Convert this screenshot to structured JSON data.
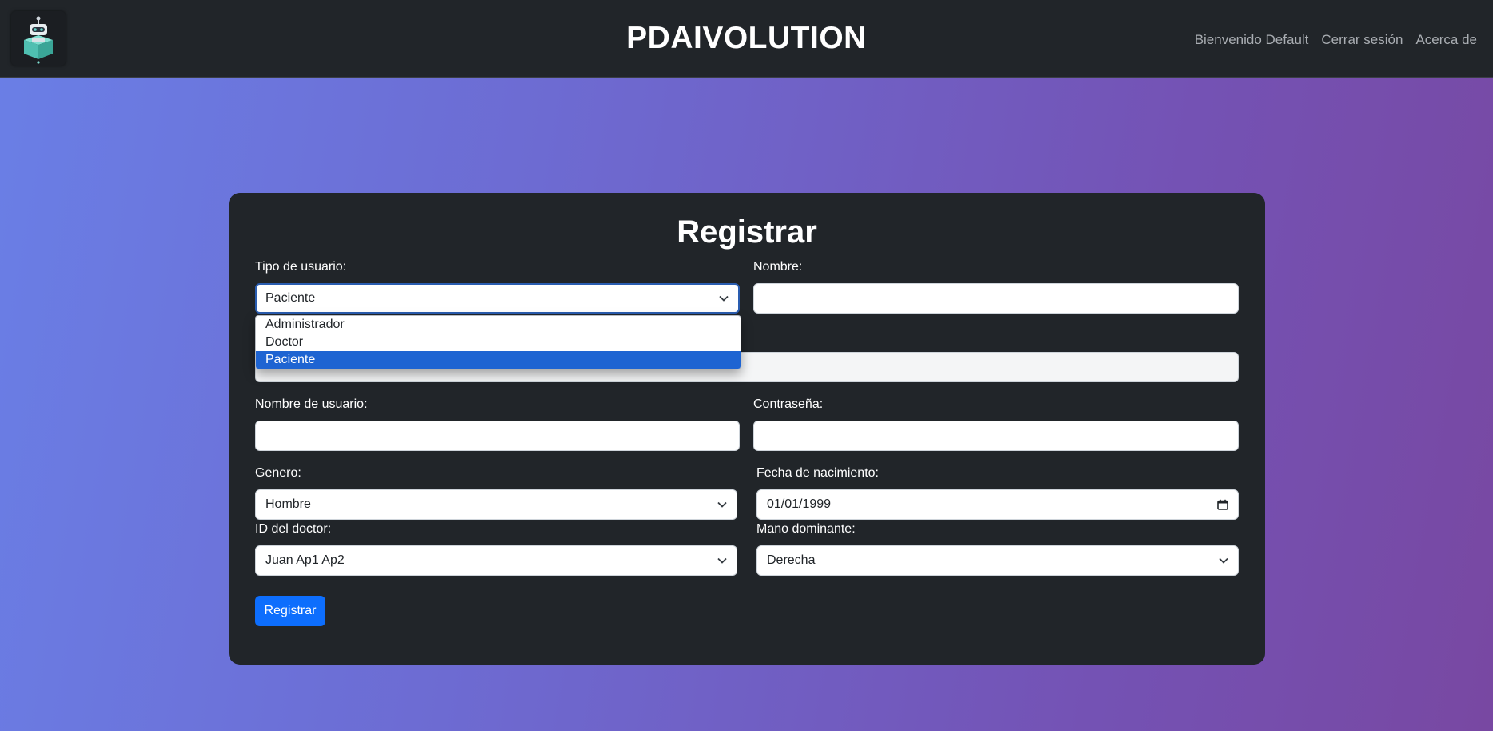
{
  "header": {
    "brand": "PDAIVOLUTION",
    "logo_icon": "robot-logo-icon",
    "links": [
      "Bienvenido Default",
      "Cerrar sesión",
      "Acerca de"
    ]
  },
  "form": {
    "title": "Registrar",
    "tipo_usuario": {
      "label": "Tipo de usuario:",
      "value": "Paciente",
      "options": [
        "Administrador",
        "Doctor",
        "Paciente"
      ],
      "selected_index": 2
    },
    "nombre": {
      "label": "Nombre:",
      "value": ""
    },
    "nombre_usuario": {
      "label": "Nombre de usuario:",
      "value": ""
    },
    "contrasena": {
      "label": "Contraseña:",
      "value": ""
    },
    "genero": {
      "label": "Genero:",
      "value": "Hombre"
    },
    "fecha_nacimiento": {
      "label": "Fecha de nacimiento:",
      "value": "01/01/1999"
    },
    "id_doctor": {
      "label": "ID del doctor:",
      "value": "Juan Ap1 Ap2"
    },
    "mano_dominante": {
      "label": "Mano dominante:",
      "value": "Derecha"
    },
    "submit_label": "Registrar"
  },
  "colors": {
    "navbar": "#212529",
    "card": "#212529",
    "primary": "#0d6efd",
    "selected_option": "#1e64d2",
    "gradient_start": "#6a7fe6",
    "gradient_end": "#7848a2"
  }
}
